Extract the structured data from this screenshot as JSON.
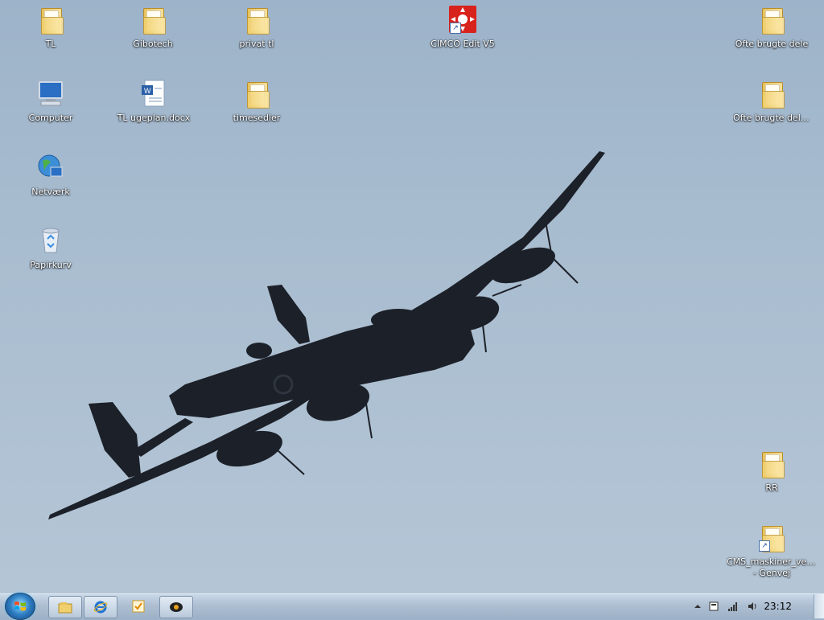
{
  "desktop": {
    "icons": [
      {
        "label": "TL"
      },
      {
        "label": "Gibotech"
      },
      {
        "label": "privat tl"
      },
      {
        "label": "CIMCO Edit V5"
      },
      {
        "label": "Ofte brugte dele"
      },
      {
        "label": "Computer"
      },
      {
        "label": "TL ugeplan.docx"
      },
      {
        "label": "timesedler"
      },
      {
        "label": "Ofte brugte dele.zip"
      },
      {
        "label": "Netværk"
      },
      {
        "label": "Papirkurv"
      },
      {
        "label": "RR"
      },
      {
        "label": "CMS_maskiner_ved_... - Genvej"
      }
    ]
  },
  "taskbar": {
    "clock": "23:12",
    "tray_icons": [
      "show-hidden-icons-icon",
      "action-center-icon",
      "network-signal-icon",
      "volume-icon"
    ],
    "pinned": [
      "windows-explorer-icon",
      "internet-explorer-icon",
      "outlook-task-icon",
      "media-app-icon"
    ]
  },
  "colors": {
    "sky": "#a9bdd0",
    "taskbar": "#aebfd2",
    "plane": "#1c2028"
  }
}
